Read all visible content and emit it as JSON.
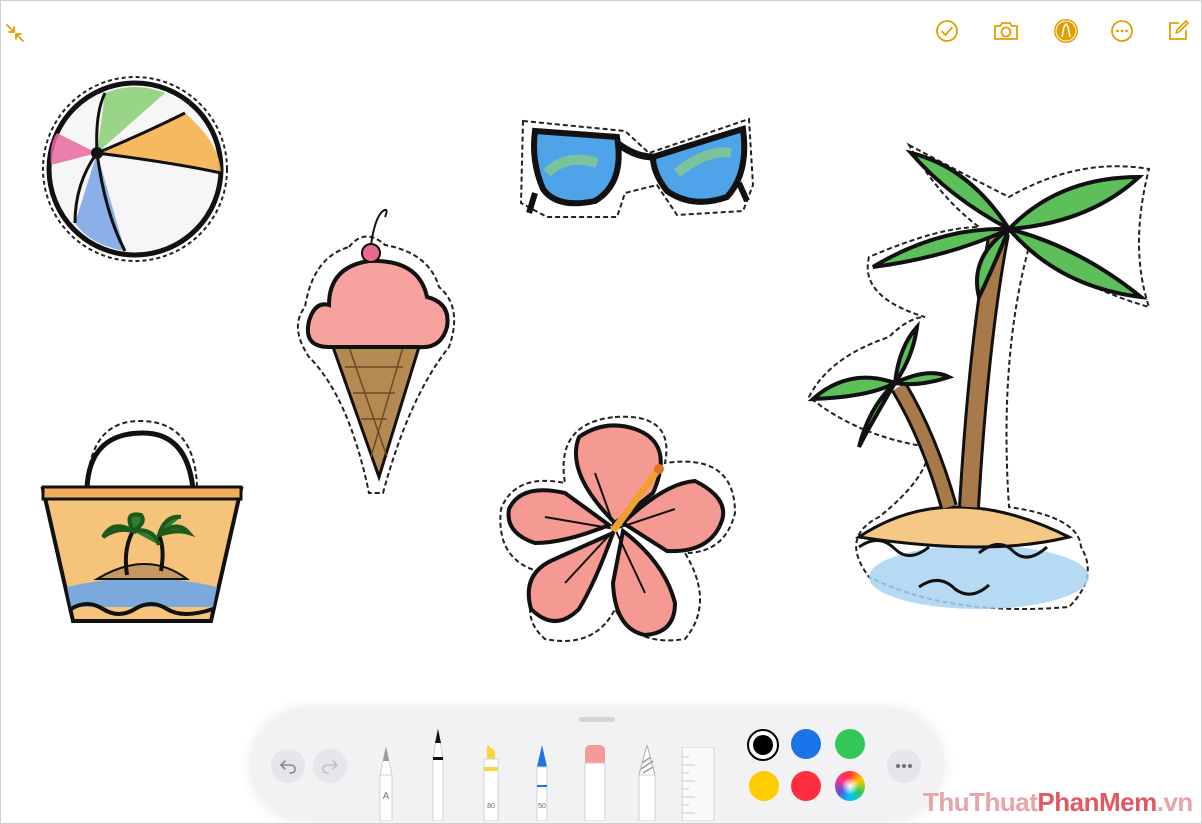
{
  "header": {
    "icons": [
      "collapse-icon",
      "done-checkmark-icon",
      "camera-icon",
      "markup-pen-icon",
      "more-ellipsis-icon",
      "compose-icon"
    ]
  },
  "canvas": {
    "stickers": [
      "beach-ball",
      "sunglasses",
      "palm-tree-island",
      "ice-cream-cone",
      "beach-bag",
      "hibiscus-flower"
    ]
  },
  "toolbar": {
    "undo": "undo-icon",
    "redo": "redo-icon",
    "tools": {
      "pen_letter": "A",
      "marker_size": "80",
      "pencil_size": "50"
    },
    "colors": [
      "#000000",
      "#1a73e8",
      "#34c759",
      "#ffcc00",
      "#ff2d40",
      "color-wheel"
    ],
    "selected_color": "#000000",
    "more": "more-ellipsis-icon"
  },
  "accent_color": "#e0a000",
  "watermark": {
    "part1": "ThuThuat",
    "part2": "PhanMem",
    "part3": ".vn"
  }
}
